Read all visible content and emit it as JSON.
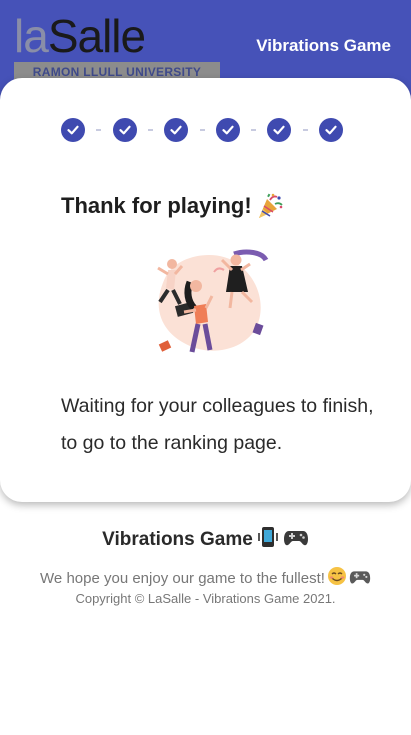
{
  "header": {
    "logo": {
      "word_light": "la",
      "word_dark": "Salle",
      "band_text": "RAMON LLULL UNIVERSITY",
      "icon": "lasalle-logo"
    },
    "app_title": "Vibrations Game",
    "background_color": "#4652b8"
  },
  "progress": {
    "steps": [
      {
        "status": "completed",
        "icon": "check-icon"
      },
      {
        "status": "completed",
        "icon": "check-icon"
      },
      {
        "status": "completed",
        "icon": "check-icon"
      },
      {
        "status": "completed",
        "icon": "check-icon"
      },
      {
        "status": "completed",
        "icon": "check-icon"
      },
      {
        "status": "completed",
        "icon": "check-icon"
      }
    ],
    "completed_count": 6,
    "total_count": 6,
    "accent_color": "#3f4ab0"
  },
  "main": {
    "title": "Thank for playing!",
    "title_emoji": "party-popper-icon",
    "illustration": "celebrating-people-illustration",
    "message": "Waiting for your colleagues to finish, to go to the ranking page."
  },
  "footer": {
    "title": "Vibrations Game",
    "title_icons": [
      "phone-vibrate-icon",
      "gamepad-icon"
    ],
    "tagline": "We hope you enjoy our game to the fullest!",
    "tagline_icons": [
      "smiling-face-icon",
      "gamepad-icon"
    ],
    "copyright": "Copyright © LaSalle - Vibrations Game 2021."
  }
}
